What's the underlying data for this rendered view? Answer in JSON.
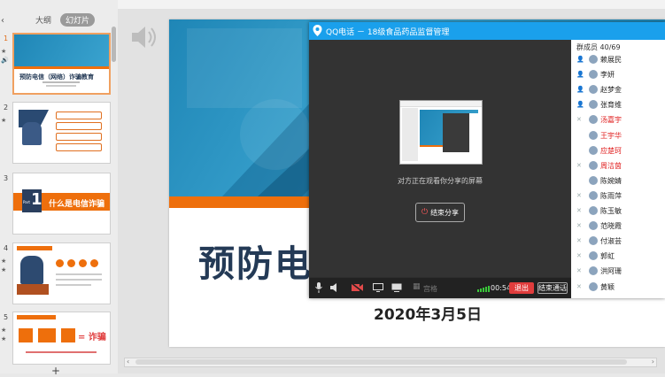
{
  "panel": {
    "tabs": [
      "大纲",
      "幻灯片"
    ],
    "active_tab": "幻灯片",
    "thumbnails": [
      {
        "num": "1",
        "title": "预防电信（网络）诈骗教育"
      },
      {
        "num": "2"
      },
      {
        "num": "3",
        "part": "Part",
        "part_num": "1",
        "title": "什么是电信诈骗"
      },
      {
        "num": "4"
      },
      {
        "num": "5",
        "equation": "= 诈骗"
      }
    ]
  },
  "slide": {
    "title": "预防电信",
    "date": "2020年3月5日"
  },
  "qq": {
    "title": "QQ电话 － 18级食品药品监督管理",
    "viewing_text": "对方正在观看你分享的屏幕",
    "stop_share_label": "结束分享",
    "toolbar": {
      "grid_label": "宫格",
      "timer": "00:54",
      "exit_label": "退出",
      "end_call_label": "结束通话"
    },
    "members_header": "群成员 40/69",
    "members": [
      {
        "name": "赖展民",
        "color": "normal",
        "icon": "user-icon"
      },
      {
        "name": "李妍",
        "color": "normal",
        "icon": "user-icon"
      },
      {
        "name": "赵梦金",
        "color": "normal",
        "icon": "user-icon"
      },
      {
        "name": "张育维",
        "color": "normal",
        "icon": "user-icon"
      },
      {
        "name": "汤嘉宇",
        "color": "red",
        "icon": "mic-muted-icon"
      },
      {
        "name": "王宇华",
        "color": "red",
        "icon": "none"
      },
      {
        "name": "应楚珂",
        "color": "red",
        "icon": "none"
      },
      {
        "name": "周洁茵",
        "color": "red",
        "icon": "mic-muted-icon"
      },
      {
        "name": "陈婉婧",
        "color": "normal",
        "icon": "none"
      },
      {
        "name": "陈雨萍",
        "color": "normal",
        "icon": "mic-muted-icon"
      },
      {
        "name": "陈玉敏",
        "color": "normal",
        "icon": "mic-muted-icon"
      },
      {
        "name": "范晓霞",
        "color": "normal",
        "icon": "mic-muted-icon"
      },
      {
        "name": "付淑芸",
        "color": "normal",
        "icon": "mic-muted-icon"
      },
      {
        "name": "郭虹",
        "color": "normal",
        "icon": "mic-muted-icon"
      },
      {
        "name": "洪阿珊",
        "color": "normal",
        "icon": "mic-muted-icon"
      },
      {
        "name": "黄颖",
        "color": "normal",
        "icon": "mic-muted-icon"
      }
    ]
  },
  "colors": {
    "accent_blue": "#1aa0ec",
    "slide_orange": "#ee6f0c",
    "exit_red": "#e03c3c"
  }
}
